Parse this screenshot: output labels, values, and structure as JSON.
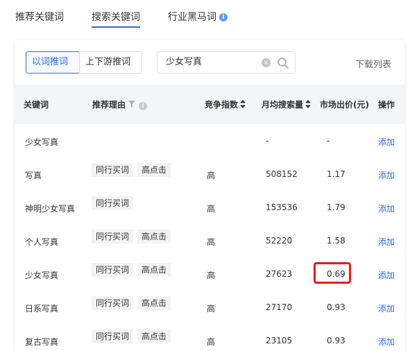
{
  "top_tabs": [
    {
      "label": "推荐关键词"
    },
    {
      "label": "搜索关键词"
    },
    {
      "label": "行业黑马词"
    }
  ],
  "toolbar": {
    "mode_options": [
      "以词推词",
      "上下游推词"
    ],
    "selected_mode": "以词推词",
    "search_value": "少女写真",
    "download_label": "下载列表"
  },
  "table": {
    "headers": {
      "keyword": "关键词",
      "reason": "推荐理由",
      "competition": "竞争指数",
      "monthly_search": "月均搜索量",
      "market_bid": "市场出价(元)",
      "action": "操作"
    },
    "rows": [
      {
        "keyword": "少女写真",
        "tags": [],
        "competition": "",
        "monthly_search": "-",
        "market_bid": "-",
        "action": "添加"
      },
      {
        "keyword": "写真",
        "tags": [
          "同行买词",
          "高点击"
        ],
        "competition": "高",
        "monthly_search": "508152",
        "market_bid": "1.17",
        "action": "添加"
      },
      {
        "keyword": "神明少女写真",
        "tags": [
          "同行买词"
        ],
        "competition": "高",
        "monthly_search": "153536",
        "market_bid": "1.79",
        "action": "添加"
      },
      {
        "keyword": "个人写真",
        "tags": [
          "同行买词",
          "高点击"
        ],
        "competition": "高",
        "monthly_search": "52220",
        "market_bid": "1.58",
        "action": "添加"
      },
      {
        "keyword": "少女写真",
        "tags": [
          "同行买词",
          "高点击"
        ],
        "competition": "高",
        "monthly_search": "27623",
        "market_bid": "0.69",
        "action": "添加"
      },
      {
        "keyword": "日系写真",
        "tags": [
          "同行买词",
          "高点击"
        ],
        "competition": "高",
        "monthly_search": "27170",
        "market_bid": "0.93",
        "action": "添加"
      },
      {
        "keyword": "复古写真",
        "tags": [
          "同行买词",
          "高点击"
        ],
        "competition": "高",
        "monthly_search": "23105",
        "market_bid": "0.93",
        "action": "添加"
      }
    ]
  },
  "colors": {
    "accent": "#2d6cdf",
    "highlight_box": "#e8191c",
    "header_bg": "#f4f5f7",
    "tag_bg": "#f3f3f3"
  },
  "icons": [
    "info-icon",
    "clear-icon",
    "search-icon",
    "filter-icon",
    "sort-icon"
  ]
}
